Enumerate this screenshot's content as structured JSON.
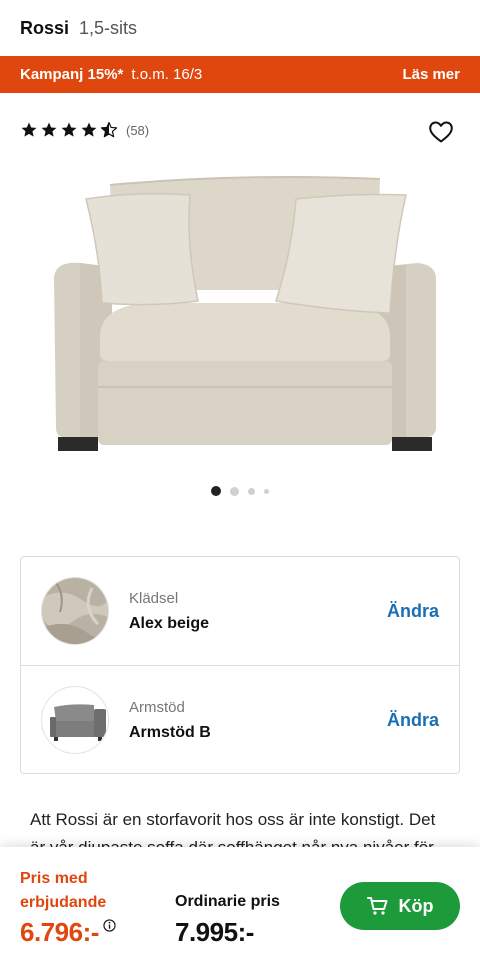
{
  "header": {
    "name": "Rossi",
    "variant": "1,5-sits"
  },
  "banner": {
    "promo": "Kampanj 15%*",
    "dates": "t.o.m. 16/3",
    "link": "Läs mer",
    "color": "#e0470e"
  },
  "rating": {
    "stars": 4.5,
    "count": "(58)"
  },
  "gallery": {
    "images": 4,
    "active_index": 0
  },
  "options": [
    {
      "label": "Klädsel",
      "value": "Alex beige",
      "action": "Ändra",
      "thumb": "fabric-swatch"
    },
    {
      "label": "Armstöd",
      "value": "Armstöd B",
      "action": "Ändra",
      "thumb": "armrest-sofa"
    }
  ],
  "description": "Att Rossi är en storfavorit hos oss är inte konstigt. Det är vår djupaste soffa där soffhänget når nya nivåer för",
  "pricing": {
    "offer_label": "Pris med erbjudande",
    "offer_price": "6.796:-",
    "regular_label": "Ordinarie pris",
    "regular_price": "7.995:-",
    "buy_label": "Köp",
    "buy_color": "#1d9b3a"
  }
}
